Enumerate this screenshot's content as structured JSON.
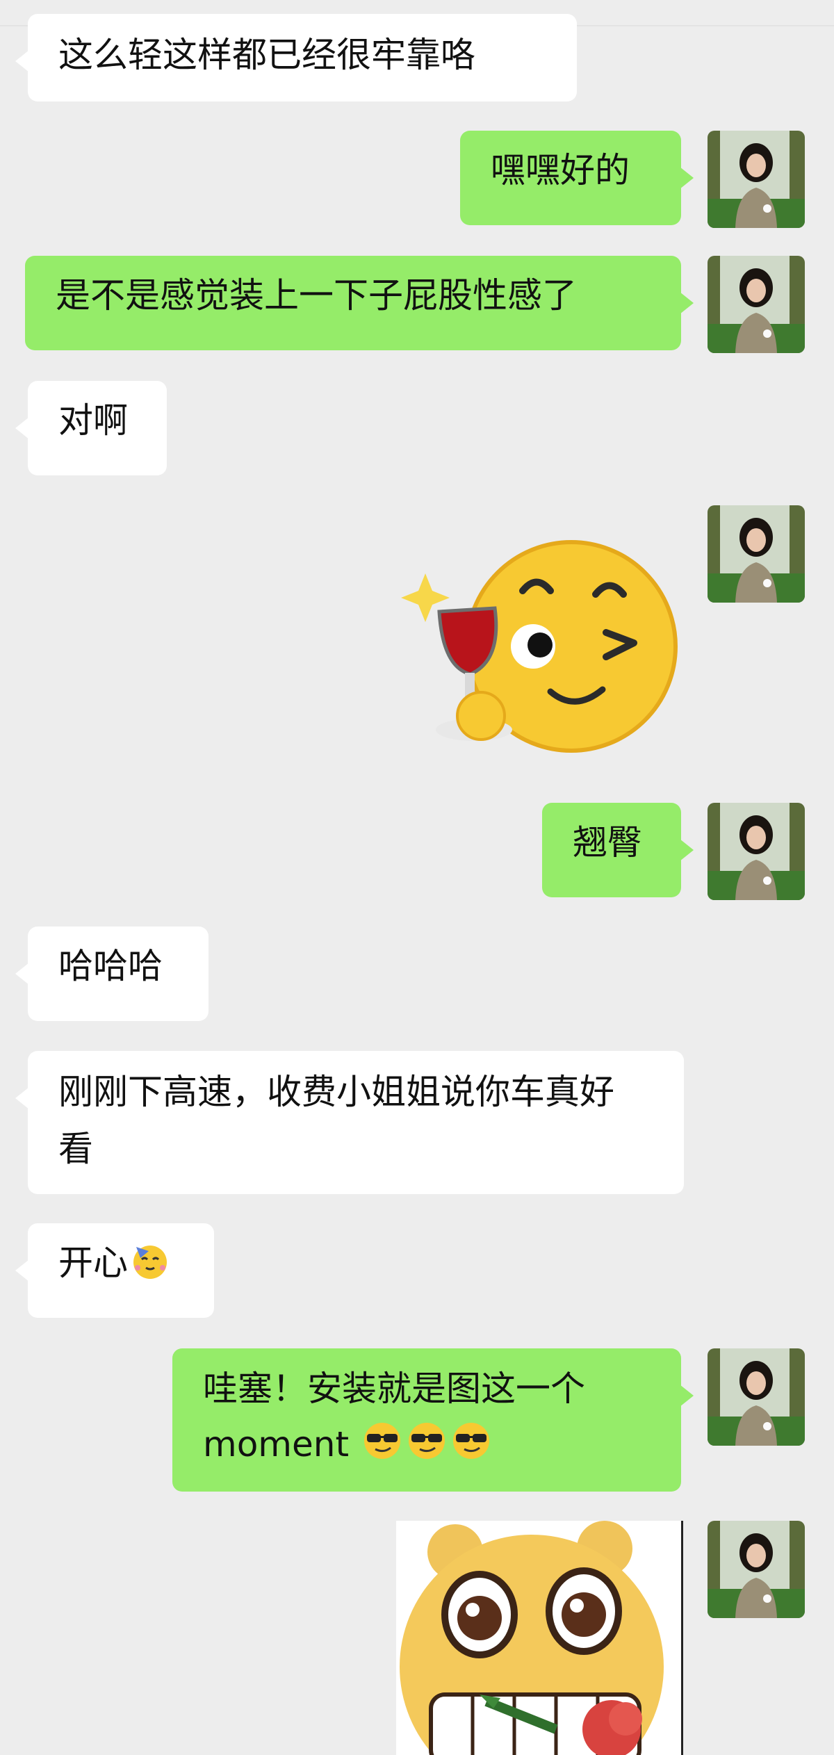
{
  "messages": [
    {
      "side": "left",
      "text": "这么轻这样都已经很牢靠咯"
    },
    {
      "side": "right",
      "text": "嘿嘿好的"
    },
    {
      "side": "right",
      "text": "是不是感觉装上一下子屁股性感了"
    },
    {
      "side": "left",
      "text": "对啊"
    },
    {
      "side": "right",
      "sticker": "wine-glass-wink-emoji"
    },
    {
      "side": "right",
      "text": "翘臀"
    },
    {
      "side": "left",
      "text": "哈哈哈"
    },
    {
      "side": "left",
      "text": "刚刚下高速，收费小姐姐说你车真好看"
    },
    {
      "side": "left",
      "text": "开心",
      "emoji": "party-face-emoji"
    },
    {
      "side": "right",
      "text_line1": "哇塞！安装就是图这一个",
      "text_line2": "moment",
      "emoji": "smirk-sunglasses-emoji"
    },
    {
      "side": "right",
      "sticker": "bear-rose-grin-emoji"
    }
  ],
  "avatar": {
    "icon": "avatar-photo",
    "colors": {
      "grass": "#3f7a2f",
      "tree": "#5b6b3a",
      "sky": "#cfd9c8",
      "shirt": "#9a8f76",
      "hair": "#1a1410",
      "skin": "#e9c6ae"
    }
  },
  "colors": {
    "background": "#ededed",
    "incoming": "#ffffff",
    "outgoing": "#95ec69"
  }
}
